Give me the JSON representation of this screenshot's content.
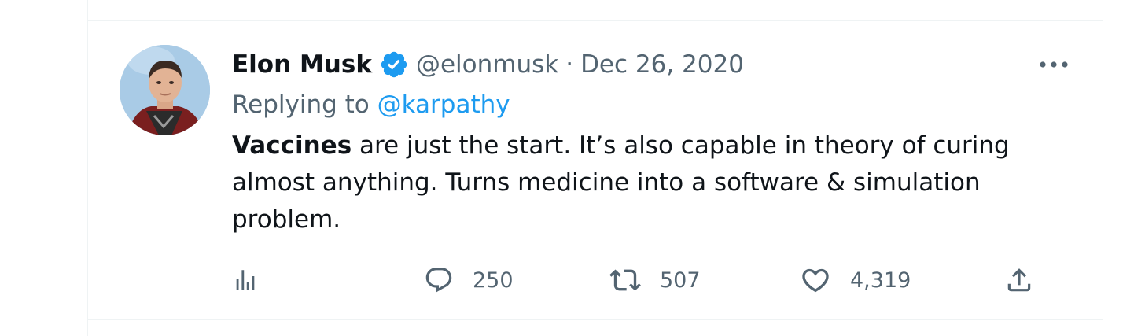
{
  "tweet": {
    "author": {
      "display_name": "Elon Musk",
      "handle": "@elonmusk",
      "verified": true,
      "avatar": "profile-photo"
    },
    "separator": "·",
    "date": "Dec 26, 2020",
    "reply": {
      "prefix": "Replying to",
      "to_handle": "@karpathy"
    },
    "text": {
      "bold_lead": "Vaccines",
      "line1_rest": " are just the start. It’s also capable in theory of curing",
      "line2": "almost anything. Turns medicine into a software & simulation",
      "line3": "problem."
    },
    "actions": {
      "analytics_icon": "analytics-icon",
      "replies": "250",
      "retweets": "507",
      "likes": "4,319",
      "share_icon": "share-icon"
    },
    "colors": {
      "link": "#1d9bf0",
      "secondary": "#536471",
      "primary_text": "#0f1419",
      "verified": "#1d9bf0"
    }
  }
}
